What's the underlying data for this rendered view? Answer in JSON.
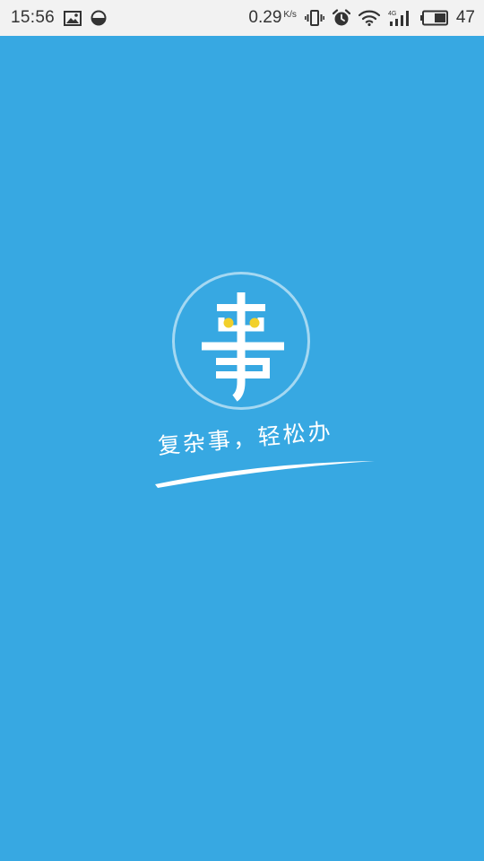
{
  "status_bar": {
    "time": "15:56",
    "net_speed": "0.29",
    "net_speed_unit": "K/s",
    "battery_level": "47",
    "icons": [
      "gallery-icon",
      "data-saver-icon",
      "vibrate-icon",
      "alarm-icon",
      "wifi-icon",
      "signal-4g-icon",
      "battery-icon"
    ]
  },
  "splash": {
    "logo_icon": "shi-character-logo-icon",
    "slogan": "复杂事，轻松办",
    "colors": {
      "background": "#37A8E2",
      "eye_dots": "#F2D02B",
      "logo_stroke": "#FFFFFF"
    }
  }
}
